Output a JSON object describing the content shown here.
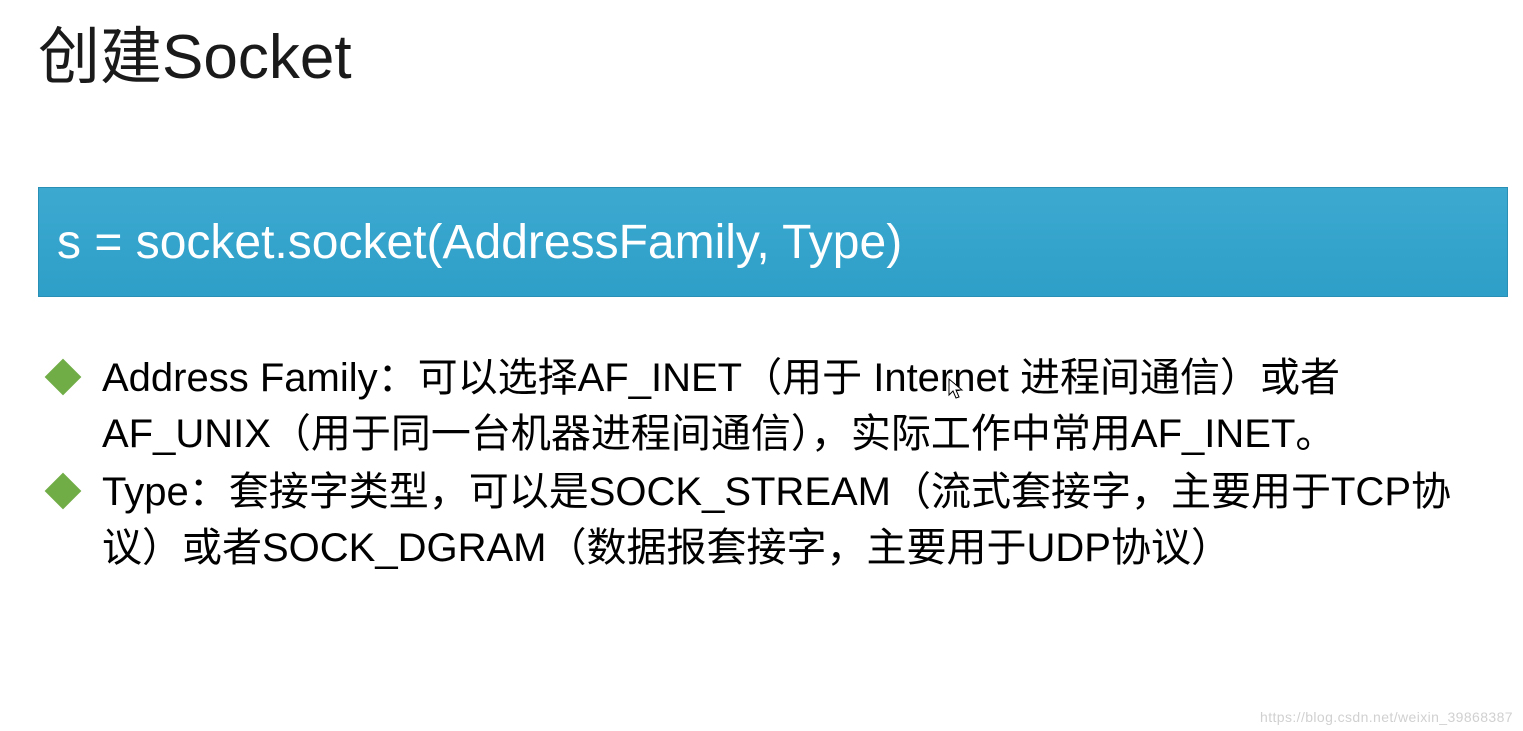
{
  "title": "创建Socket",
  "code": "s = socket.socket(AddressFamily, Type)",
  "bullets": [
    "Address Family：可以选择AF_INET（用于 Internet 进程间通信）或者AF_UNIX（用于同一台机器进程间通信），实际工作中常用AF_INET。",
    "Type：套接字类型，可以是SOCK_STREAM（流式套接字，主要用于TCP协议）或者SOCK_DGRAM（数据报套接字，主要用于UDP协议）"
  ],
  "watermark": "https://blog.csdn.net/weixin_39868387"
}
